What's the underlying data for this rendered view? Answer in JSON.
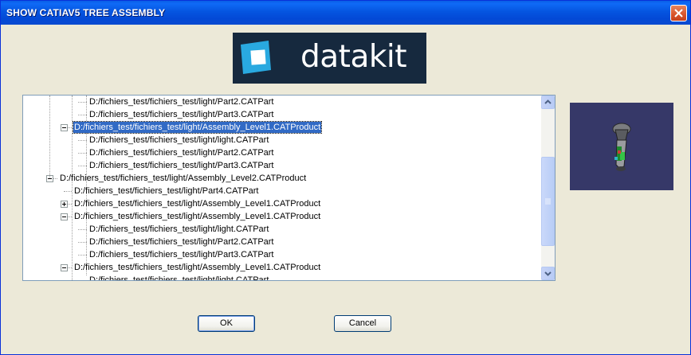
{
  "window": {
    "title": "SHOW CATIAV5 TREE ASSEMBLY",
    "close_glyph": "✕"
  },
  "logo": {
    "text": "datakit",
    "brand_color": "#16293e",
    "accent_color": "#29a9e0"
  },
  "tree": {
    "rows": [
      {
        "label": "D:/fichiers_test/fichiers_test/light/Part2.CATPart",
        "level": 3,
        "expander": "none",
        "selected": false
      },
      {
        "label": "D:/fichiers_test/fichiers_test/light/Part3.CATPart",
        "level": 3,
        "expander": "none",
        "selected": false
      },
      {
        "label": "D:/fichiers_test/fichiers_test/light/Assembly_Level1.CATProduct",
        "level": 2,
        "expander": "minus",
        "selected": true
      },
      {
        "label": "D:/fichiers_test/fichiers_test/light/light.CATPart",
        "level": 3,
        "expander": "none",
        "selected": false
      },
      {
        "label": "D:/fichiers_test/fichiers_test/light/Part2.CATPart",
        "level": 3,
        "expander": "none",
        "selected": false
      },
      {
        "label": "D:/fichiers_test/fichiers_test/light/Part3.CATPart",
        "level": 3,
        "expander": "none",
        "selected": false
      },
      {
        "label": "D:/fichiers_test/fichiers_test/light/Assembly_Level2.CATProduct",
        "level": 1,
        "expander": "minus",
        "selected": false
      },
      {
        "label": "D:/fichiers_test/fichiers_test/light/Part4.CATPart",
        "level": 2,
        "expander": "none",
        "selected": false
      },
      {
        "label": "D:/fichiers_test/fichiers_test/light/Assembly_Level1.CATProduct",
        "level": 2,
        "expander": "plus",
        "selected": false
      },
      {
        "label": "D:/fichiers_test/fichiers_test/light/Assembly_Level1.CATProduct",
        "level": 2,
        "expander": "minus",
        "selected": false
      },
      {
        "label": "D:/fichiers_test/fichiers_test/light/light.CATPart",
        "level": 3,
        "expander": "none",
        "selected": false
      },
      {
        "label": "D:/fichiers_test/fichiers_test/light/Part2.CATPart",
        "level": 3,
        "expander": "none",
        "selected": false
      },
      {
        "label": "D:/fichiers_test/fichiers_test/light/Part3.CATPart",
        "level": 3,
        "expander": "none",
        "selected": false
      },
      {
        "label": "D:/fichiers_test/fichiers_test/light/Assembly_Level1.CATProduct",
        "level": 2,
        "expander": "minus",
        "selected": false
      },
      {
        "label": "D:/fichiers_test/fichiers_test/light/light.CATPart",
        "level": 3,
        "expander": "none",
        "selected": false
      }
    ],
    "selection_color": "#316ac5",
    "scroll_position": 0.62
  },
  "preview": {
    "background_color": "#363868",
    "icon": "3d-lamp-model-icon"
  },
  "buttons": {
    "ok_label": "OK",
    "cancel_label": "Cancel"
  }
}
